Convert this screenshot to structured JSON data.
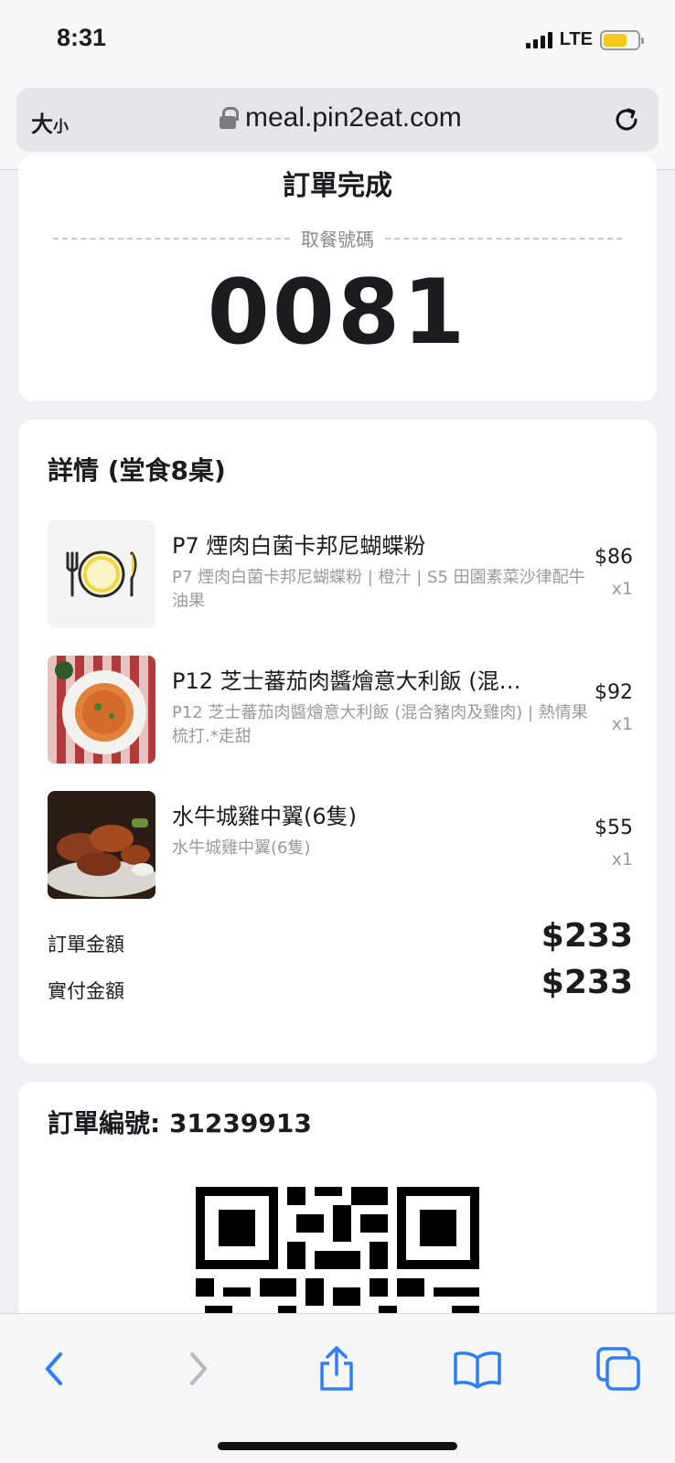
{
  "status_bar": {
    "time": "8:31",
    "network": "LTE"
  },
  "browser": {
    "text_size_label_big": "大",
    "text_size_label_small": "小",
    "url": "meal.pin2eat.com"
  },
  "order": {
    "status_title": "訂單完成",
    "pickup_label": "取餐號碼",
    "pickup_number": "0081"
  },
  "details": {
    "title": "詳情 (堂食8桌)",
    "items": [
      {
        "name": "P7 煙肉白菌卡邦尼蝴蝶粉",
        "desc": "P7 煙肉白菌卡邦尼蝴蝶粉 | 橙汁 | S5 田園素菜沙律配牛油果",
        "price": "$86",
        "qty": "x1",
        "image": "plate-cutlery-icon"
      },
      {
        "name": "P12 芝士蕃茄肉醬燴意大利飯 (混…",
        "desc": "P12 芝士蕃茄肉醬燴意大利飯 (混合豬肉及雞肉) | 熱情果梳打.*走甜",
        "price": "$92",
        "qty": "x1",
        "image": "risotto-photo"
      },
      {
        "name": "水牛城雞中翼(6隻)",
        "desc": "水牛城雞中翼(6隻)",
        "price": "$55",
        "qty": "x1",
        "image": "chicken-wings-photo"
      }
    ],
    "order_total_label": "訂單金額",
    "order_total": "$233",
    "paid_total_label": "實付金額",
    "paid_total": "$233"
  },
  "order_number": {
    "label": "訂單編號: 31239913"
  },
  "colors": {
    "accent": "#2f7ef6",
    "battery": "#f7c918"
  }
}
